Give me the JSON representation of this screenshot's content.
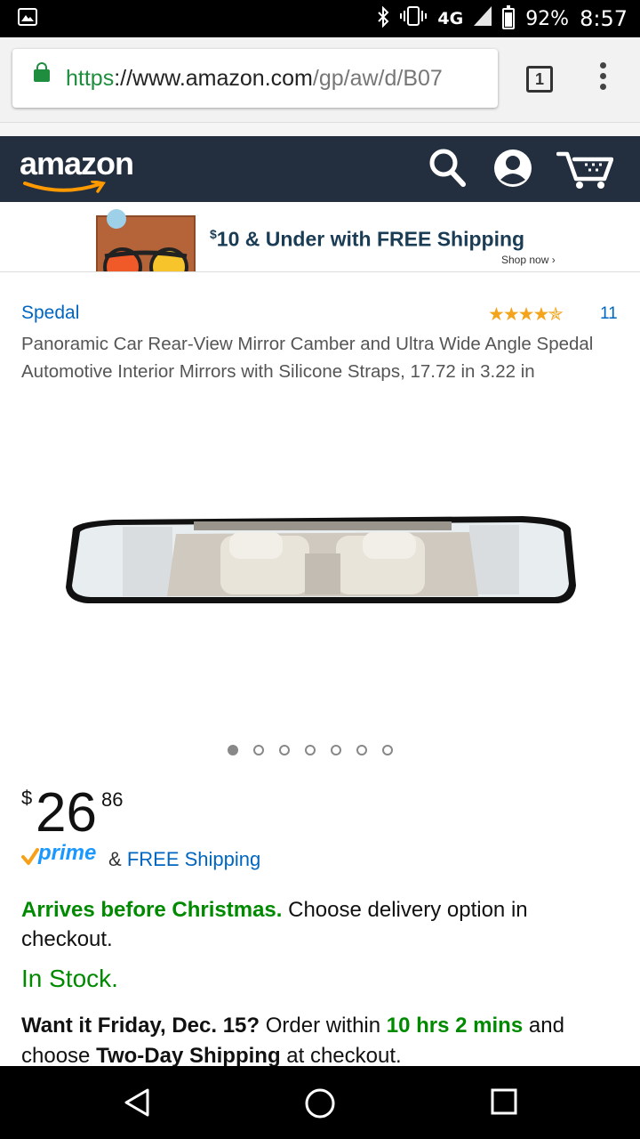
{
  "status_bar": {
    "bluetooth_icon": "bluetooth-icon",
    "vibrate_icon": "vibrate-icon",
    "network": "4G",
    "battery_pct": "92%",
    "time": "8:57"
  },
  "browser": {
    "url_scheme": "https",
    "url_host": "://www.amazon.com",
    "url_path": "/gp/aw/d/B07",
    "tab_count": "1"
  },
  "header": {
    "logo": "amazon"
  },
  "promo": {
    "dollar": "$",
    "text": "10 & Under with FREE Shipping",
    "shop_now": "Shop now ›"
  },
  "product": {
    "brand": "Spedal",
    "stars": "★★★★✯",
    "rating": 4.5,
    "review_count": "11",
    "title": "Panoramic Car Rear-View Mirror Camber and Ultra Wide Angle Spedal Automotive Interior Mirrors with Silicone Straps, 17.72 in 3.22 in",
    "image_count": 7,
    "active_image": 1
  },
  "price": {
    "currency": "$",
    "whole": "26",
    "fraction": "86"
  },
  "shipping": {
    "prime": "prime",
    "amp": "&",
    "free": "FREE Shipping"
  },
  "delivery": {
    "highlight": "Arrives before Christmas.",
    "rest": " Choose delivery option in checkout."
  },
  "stock": "In Stock.",
  "want_it": {
    "lead": "Want it Friday, Dec. 15?",
    "order_within": " Order within ",
    "countdown": "10 hrs 2 mins",
    "and_choose": " and choose ",
    "method": "Two-Day Shipping",
    "tail": " at checkout."
  },
  "colors": {
    "amazon_header": "#232f3e",
    "link_blue": "#0066c0",
    "in_stock_green": "#008a00",
    "star_orange": "#f4a41c"
  }
}
